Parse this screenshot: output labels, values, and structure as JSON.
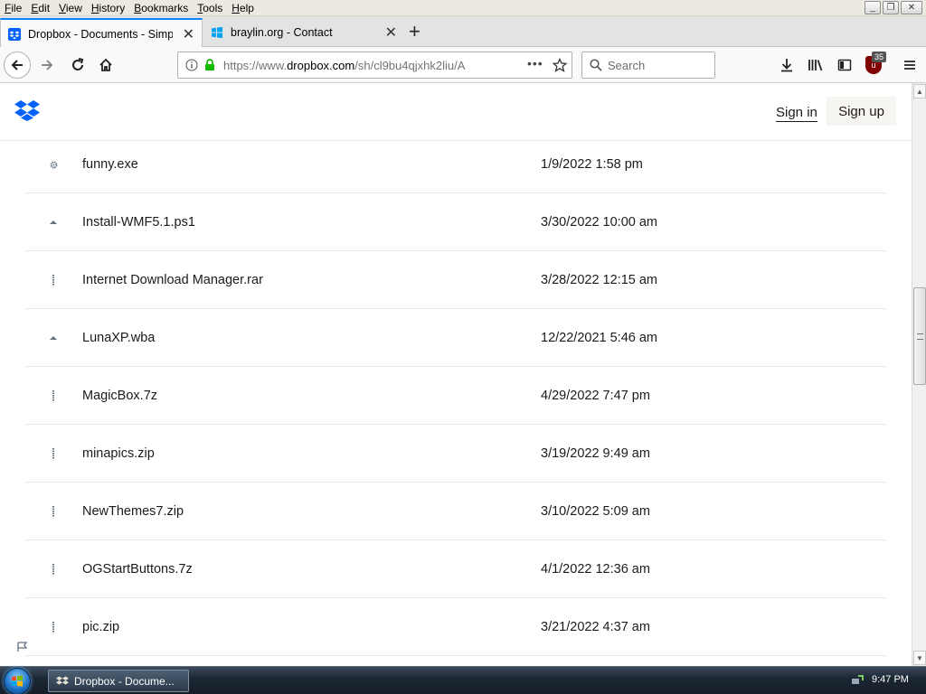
{
  "menubar": {
    "items": [
      "File",
      "Edit",
      "View",
      "History",
      "Bookmarks",
      "Tools",
      "Help"
    ]
  },
  "tabs": [
    {
      "title": "Dropbox - Documents - Simplif",
      "active": true,
      "icon": "dropbox-favicon"
    },
    {
      "title": "braylin.org - Contact",
      "active": false,
      "icon": "windows-favicon"
    }
  ],
  "navbar": {
    "url_prefix": "https://www.",
    "url_domain": "dropbox.com",
    "url_rest": "/sh/cl9bu4qjxhk2liu/A",
    "search_placeholder": "Search",
    "ublock_count": "35"
  },
  "site": {
    "signin_label": "Sign in",
    "signup_label": "Sign up"
  },
  "files": [
    {
      "name": "funny.exe",
      "date": "1/9/2022 1:58 pm",
      "icon": "gear-icon"
    },
    {
      "name": "Install-WMF5.1.ps1",
      "date": "3/30/2022 10:00 am",
      "icon": "script-icon"
    },
    {
      "name": "Internet Download Manager.rar",
      "date": "3/28/2022 12:15 am",
      "icon": "zip-icon"
    },
    {
      "name": "LunaXP.wba",
      "date": "12/22/2021 5:46 am",
      "icon": "script-icon"
    },
    {
      "name": "MagicBox.7z",
      "date": "4/29/2022 7:47 pm",
      "icon": "zip-icon"
    },
    {
      "name": "minapics.zip",
      "date": "3/19/2022 9:49 am",
      "icon": "zip-icon"
    },
    {
      "name": "NewThemes7.zip",
      "date": "3/10/2022 5:09 am",
      "icon": "zip-icon"
    },
    {
      "name": "OGStartButtons.7z",
      "date": "4/1/2022 12:36 am",
      "icon": "zip-icon"
    },
    {
      "name": "pic.zip",
      "date": "3/21/2022 4:37 am",
      "icon": "zip-icon"
    }
  ],
  "taskbar": {
    "window_label": "Dropbox - Docume...",
    "clock": "9:47 PM"
  },
  "colors": {
    "dropbox_blue": "#0061fe",
    "firefox_accent": "#0a84ff",
    "ublock_red": "#800000"
  }
}
